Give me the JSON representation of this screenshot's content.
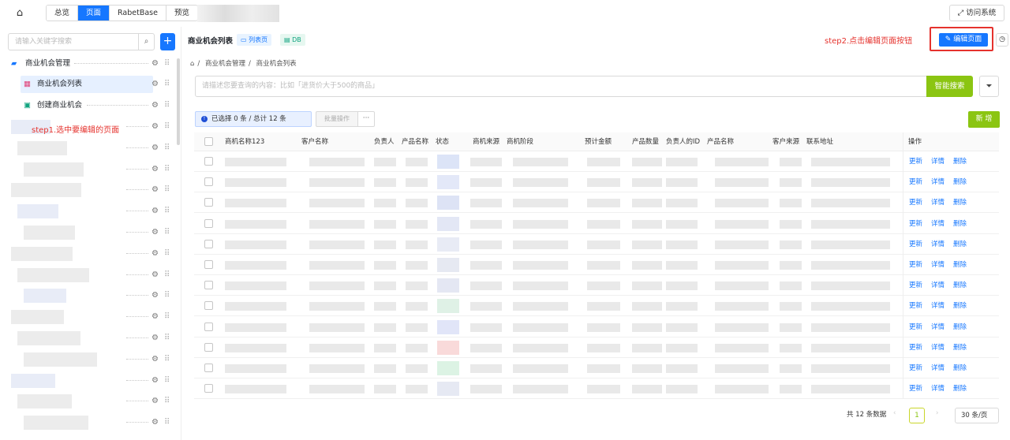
{
  "topbar": {
    "tabs": [
      {
        "label": "总览",
        "active": false
      },
      {
        "label": "页面",
        "active": true
      },
      {
        "label": "RabetBase",
        "active": false
      },
      {
        "label": "预览",
        "active": false
      }
    ],
    "visit_label": "访问系统"
  },
  "sidebar": {
    "search_placeholder": "请输入关键字搜索",
    "tree": [
      {
        "label": "商业机会管理",
        "icon": "folder-icon",
        "level": 0
      },
      {
        "label": "商业机会列表",
        "icon": "table-icon",
        "level": 1,
        "selected": true
      },
      {
        "label": "创建商业机会",
        "icon": "form-icon",
        "level": 1
      }
    ],
    "step1": "step1.选中要编辑的页面"
  },
  "page": {
    "title": "商业机会列表",
    "tag_list": "列表页",
    "tag_db": "DB",
    "step2": "step2.点击编辑页面按钮",
    "edit_label": "编辑页面",
    "breadcrumb": [
      "商业机会管理",
      "商业机会列表"
    ],
    "ai_placeholder": "请描述您要查询的内容：比如「进货价大于500的商品」",
    "ai_button": "智能搜索",
    "selection_info": "已选择 0 条 / 总计 12 条",
    "batch_label": "批量操作",
    "more_label": "···",
    "new_label": "新 增"
  },
  "table": {
    "columns": [
      "商机名称123",
      "客户名称",
      "负责人",
      "产品名称",
      "状态",
      "商机来源",
      "商机阶段",
      "预计金额",
      "产品数量",
      "负责人的ID",
      "产品名称",
      "客户来源",
      "联系地址"
    ],
    "action_header": "操作",
    "row_actions": [
      "更新",
      "详情",
      "删除"
    ],
    "row_count": 12
  },
  "pagination": {
    "total": "共 12 条数据",
    "current": "1",
    "page_size": "30 条/页"
  },
  "colors": {
    "primary": "#1677ff",
    "accent_green": "#8bc512",
    "annotation_red": "#e5322d"
  }
}
